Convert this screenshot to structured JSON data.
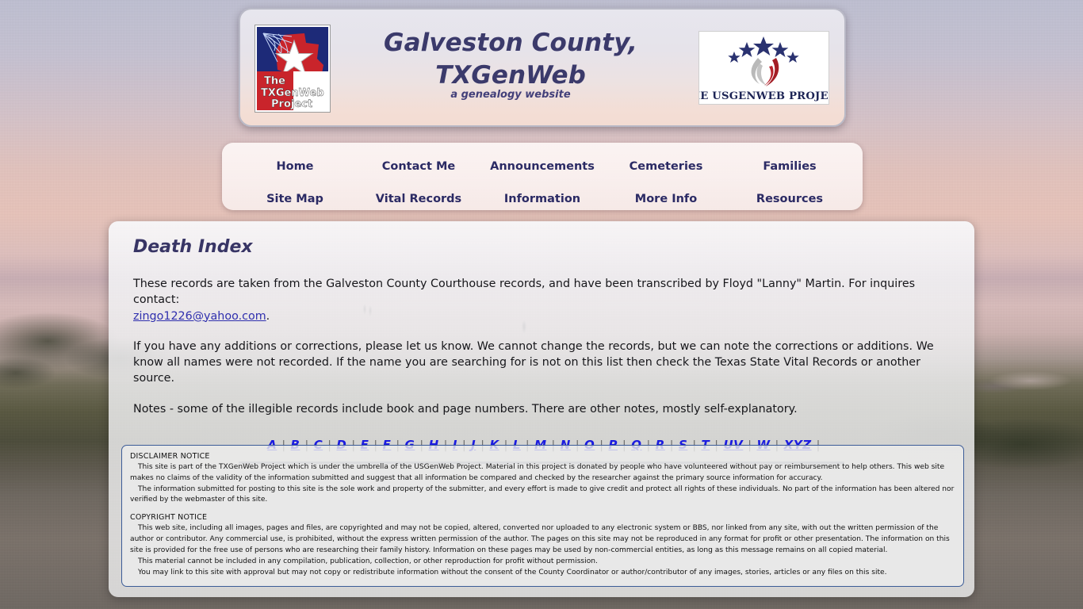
{
  "header": {
    "title_line1": "Galveston County,",
    "title_line2": "TXGenWeb",
    "subtitle": "a genealogy website",
    "tx_logo": {
      "name": "txgenweb-project-logo",
      "line1": "The",
      "line2": "TXGenWeb",
      "line3": "Project"
    },
    "us_logo": {
      "name": "usgenweb-project-logo",
      "caption": "THE USGENWEB PROJECT"
    },
    "colors": {
      "title_text": "#3b3a6b",
      "card_border": "#b9b9c6"
    }
  },
  "nav": {
    "row1": [
      {
        "label": "Home"
      },
      {
        "label": "Contact Me"
      },
      {
        "label": "Announcements"
      },
      {
        "label": "Cemeteries"
      },
      {
        "label": "Families"
      }
    ],
    "row2": [
      {
        "label": "Site Map"
      },
      {
        "label": "Vital Records"
      },
      {
        "label": "Information"
      },
      {
        "label": "More Info"
      },
      {
        "label": "Resources"
      }
    ]
  },
  "main": {
    "title": "Death Index",
    "paragraph1_before": "These records are taken from the Galveston County Courthouse records, and have been transcribed by Floyd \"Lanny\" Martin. For inquires contact: ",
    "paragraph1_email": "zingo1226@yahoo.com",
    "paragraph1_after": ".",
    "paragraph2": "If you have any additions or corrections, please let us know. We cannot change the records, but we can note the corrections or additions. We know all names were not recorded. If the name you are searching for is not on this list then check the Texas State Vital Records or another source.",
    "paragraph3": "Notes - some of the illegible records include book and page numbers. There are other notes, mostly self-explanatory.",
    "alpha_links": [
      "A",
      "B",
      "C",
      "D",
      "E",
      "F",
      "G",
      "H",
      "I",
      "J",
      "K",
      "L",
      "M",
      "N",
      "O",
      "P",
      "Q",
      "R",
      "S",
      "T",
      "UV",
      "W",
      "XYZ"
    ],
    "alpha_separator": "|",
    "link_color": "#1c1ce0"
  },
  "notices": {
    "disclaimer_heading": "DISCLAIMER NOTICE",
    "disclaimer_p1": "This site is part of the TXGenWeb Project which is under the umbrella of the USGenWeb Project. Material in this project is donated by people who have volunteered without pay or reimbursement to help others. This web site makes no claims of the validity of the information submitted and suggest that all information be compared and checked by the researcher against the primary source information for accuracy.",
    "disclaimer_p2": "The information submitted for posting to this site is the sole work and property of the submitter, and every effort is made to give credit and protect all rights of these individuals. No part of the information has been altered nor verified by the webmaster of this site.",
    "copyright_heading": "COPYRIGHT NOTICE",
    "copyright_p1": "This web site, including all images, pages and files, are copyrighted and may not be copied, altered, converted nor uploaded to any electronic system or BBS, nor linked from any site, with out the written permission of the author or contributor. Any commercial use, is prohibited, without the express written permission of the author. The pages on this site may not be reproduced in any format for profit or other presentation. The information on this site is provided for the free use of persons who are researching their family history. Information on these pages may be used by non-commercial entities, as long as this message remains on all copied material.",
    "copyright_p2": "This material cannot be included in any compilation, publication, collection, or other reproduction for profit without permission.",
    "copyright_p3": "You may link to this site with approval but may not copy or redistribute information without the consent of the County Coordinator or author/contributor of any images, stories, articles or any files on this site.",
    "border_color": "#3c5c97"
  }
}
